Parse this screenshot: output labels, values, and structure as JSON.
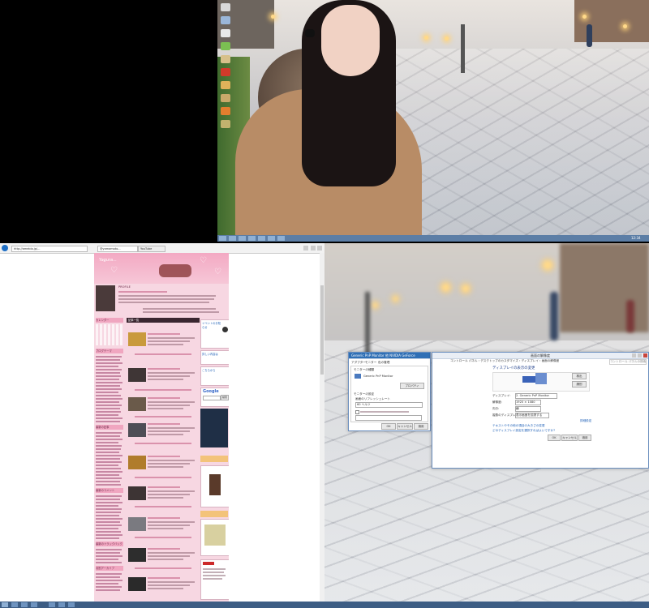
{
  "top_monitor": {
    "taskbar_tray": "12:34"
  },
  "browser": {
    "address": "http://ameblo.jp/...",
    "tab_1": "@yamamoto...",
    "tab_2": "YouTube",
    "blog": {
      "title_script": "Yagura...",
      "profile_label": "PROFILE",
      "sidebar_heading_1": "カレンダー",
      "sidebar_heading_2": "ブログテーマ",
      "sidebar_heading_3": "最新の記事",
      "sidebar_heading_4": "最新のコメント",
      "sidebar_heading_5": "最新のトラックバック",
      "sidebar_heading_6": "月別アーカイブ",
      "google_label": "Google",
      "google_button": "検索",
      "side_ad_1": "イベントのお知らせ",
      "side_ad_2": "詳しい内容は",
      "side_ad_3": "こちらから",
      "entries_heading": "記事一覧"
    }
  },
  "dialog_left": {
    "title": "Generic PnP Monitor 他 NVIDIA GeForce",
    "tabs": [
      "アダプター",
      "モニター",
      "色の管理"
    ],
    "section_1": "モニターの種類",
    "section_1_value": "Generic PnP Monitor",
    "properties_button": "プロパティ",
    "section_2": "モニターの設定",
    "refresh_label": "画面のリフレッシュレート",
    "refresh_value": "60 ヘルツ",
    "ok": "OK",
    "cancel": "キャンセル",
    "apply": "適用"
  },
  "dialog_right": {
    "title": "画面の解像度",
    "breadcrumb": "コントロール パネル › デスクトップのカスタマイズ › ディスプレイ › 画面の解像度",
    "search_placeholder": "コントロール パネルの検索",
    "heading": "ディスプレイの表示の変更",
    "detect": "検出",
    "identify": "識別",
    "display_label": "ディスプレイ:",
    "display_value": "2. Generic PnP Monitor",
    "resolution_label": "解像度:",
    "resolution_value": "1920 × 1080",
    "orientation_label": "向き:",
    "orientation_value": "横",
    "multi_label": "複数のディスプレイ:",
    "multi_value": "表示画面を拡張する",
    "advanced_link": "詳細設定",
    "link_1": "テキストやその他の項目の大きさの変更",
    "link_2": "どのディスプレイ設定を選択すればよいですか?",
    "ok": "OK",
    "cancel": "キャンセル",
    "apply": "適用"
  },
  "colors": {
    "accent": "#3d5d84",
    "blog_pink": "#f7d7e2",
    "dialog_border": "#6b8fbf"
  }
}
